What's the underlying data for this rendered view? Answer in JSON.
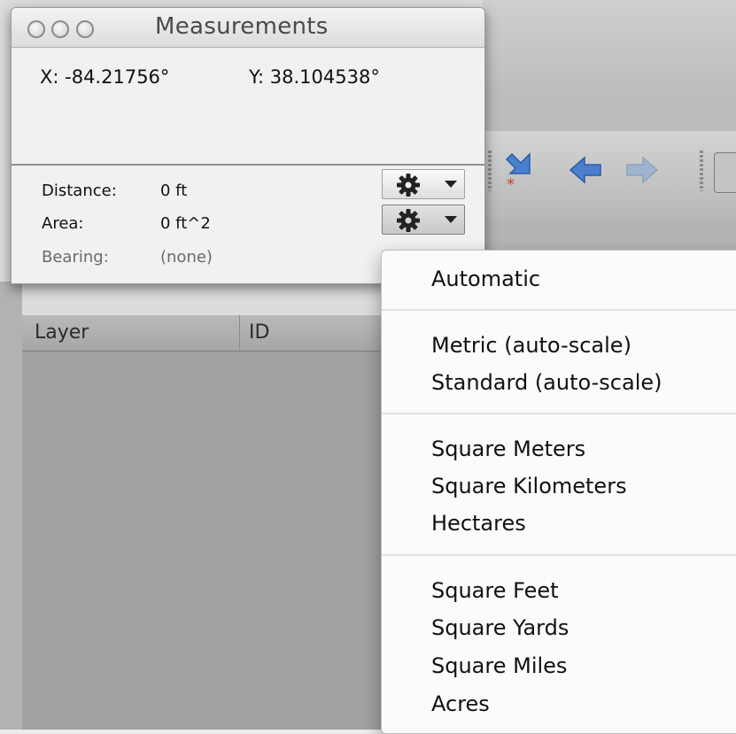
{
  "measurements_window": {
    "title": "Measurements",
    "coordinates": {
      "x": "X:  -84.21756°",
      "y": "Y:  38.104538°"
    },
    "distance": {
      "label": "Distance:",
      "value": "0 ft"
    },
    "area": {
      "label": "Area:",
      "value": "0 ft^2"
    },
    "bearing": {
      "label": "Bearing:",
      "value": "(none)"
    }
  },
  "results_table": {
    "columns": [
      "Layer",
      "ID"
    ]
  },
  "area_units_menu": {
    "items": [
      "Automatic",
      "Metric (auto-scale)",
      "Standard (auto-scale)",
      "Square Meters",
      "Square Kilometers",
      "Hectares",
      "Square Feet",
      "Square Yards",
      "Square Miles",
      "Acres"
    ]
  },
  "icons": {
    "gear": "gear-icon",
    "dropdown": "chevron-down-icon",
    "toolbar": [
      "swap-arrow-icon",
      "back-arrow-icon",
      "forward-arrow-icon"
    ]
  },
  "colors": {
    "toolbar_arrow": "#4a7fd0",
    "toolbar_arrow_disabled": "#9fb4cf",
    "marker_red": "#d93a2a"
  }
}
